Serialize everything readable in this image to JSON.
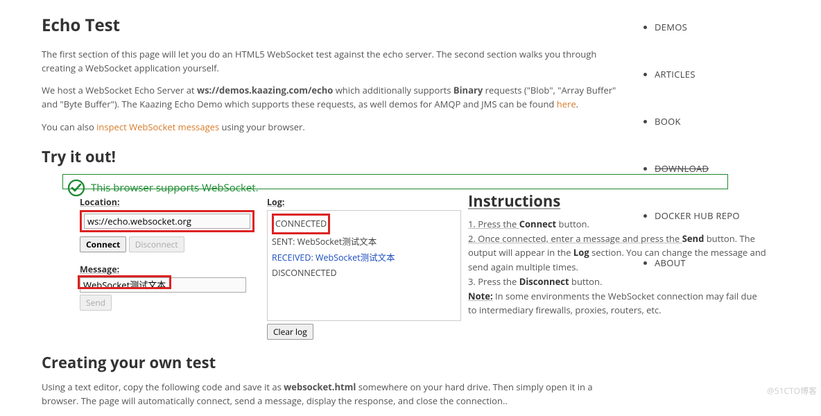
{
  "heading": "Echo Test",
  "para1a": "The first section of this page will let you do an HTML5 WebSocket test against the echo server. The second section walks you through creating a WebSocket application yourself.",
  "para2_pre": "We host a WebSocket Echo Server at ",
  "para2_bold1": "ws://demos.kaazing.com/echo",
  "para2_mid": " which additionally supports ",
  "para2_bold2": "Binary",
  "para2_post": " requests (\"Blob\", \"Array Buffer\" and \"Byte Buffer\"). The Kaazing Echo Demo which supports these requests, as well demos for AMQP and JMS can be found ",
  "here": "here",
  "para3_pre": "You can also ",
  "para3_link": "inspect WebSocket messages",
  "para3_post": " using your browser.",
  "tryout_heading": "Try it out!",
  "support_msg": "This browser supports WebSocket.",
  "location_label": "Location:",
  "location_value": "ws://echo.websocket.org",
  "connect_btn": "Connect",
  "disconnect_btn": "Disconnect",
  "message_label": "Message:",
  "message_value": "WebSocket测试文本",
  "send_btn": "Send",
  "log_label": "Log:",
  "log_connected": "CONNECTED",
  "log_sent": "SENT: WebSocket测试文本",
  "log_received": "RECEIVED: WebSocket测试文本",
  "log_disconnected": "DISCONNECTED",
  "clear_log_btn": "Clear log",
  "instructions_title": "Instructions",
  "instr_1_pre": "1. Press the ",
  "instr_1_b": "Connect",
  "instr_1_post": " button.",
  "instr_2_pre": "2. Once connected, enter a message and press the ",
  "instr_2_b": "Send",
  "instr_2_post": " button. The output will appear in the ",
  "instr_2_b2": "Log",
  "instr_2_end": " section. You can change the message and send again multiple times.",
  "instr_3_pre": "3. Press the ",
  "instr_3_b": "Disconnect",
  "instr_3_post": " button.",
  "note_b": "Note:",
  "note_text": " In some environments the WebSocket connection may fail due to intermediary firewalls, proxies, routers, etc.",
  "create_heading": "Creating your own test",
  "create_para_pre": "Using a text editor, copy the following code and save it as ",
  "create_para_b": "websocket.html",
  "create_para_post": " somewhere on your hard drive. Then simply open it in a browser. The page will automatically connect, send a message, display the response, and close the connection..",
  "nav": {
    "demos": "DEMOS",
    "articles": "ARTICLES",
    "book": "BOOK",
    "download": "DOWNLOAD",
    "docker": "DOCKER HUB REPO",
    "about": "ABOUT"
  },
  "watermark": "@51CTO博客"
}
